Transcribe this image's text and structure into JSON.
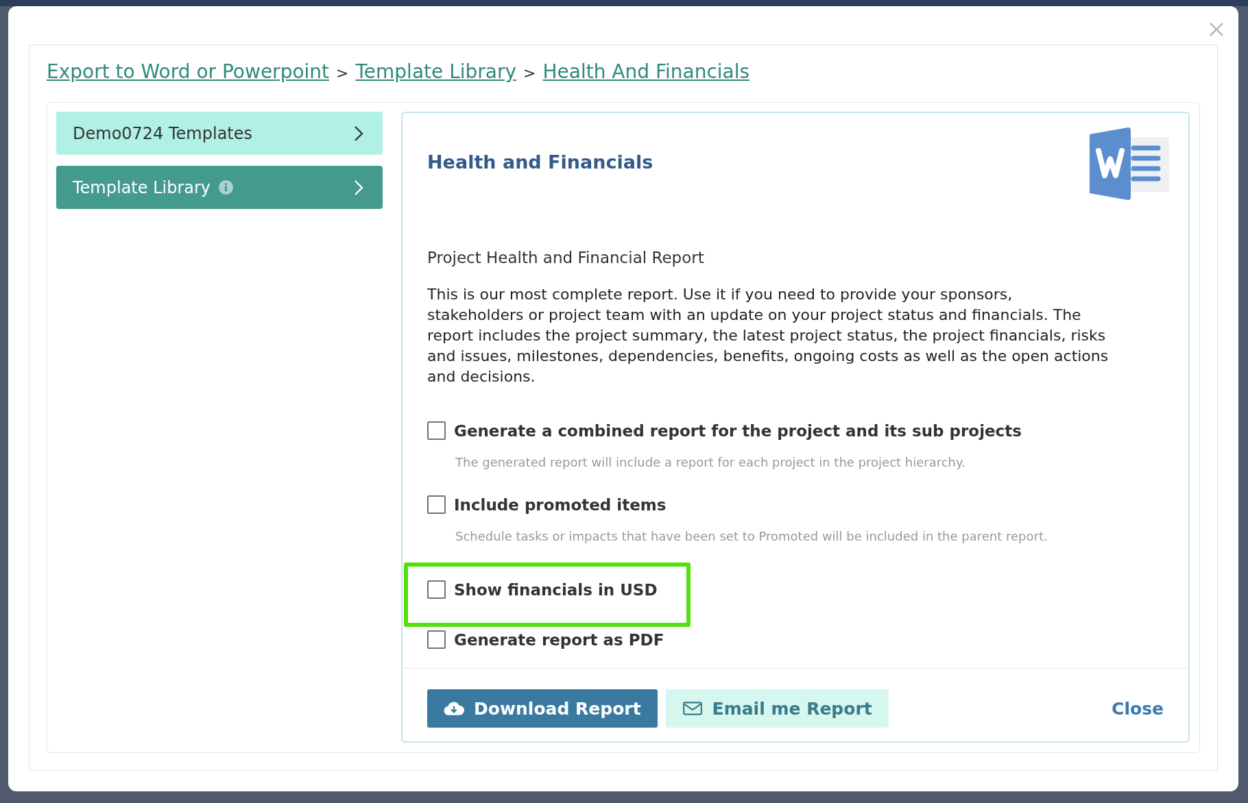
{
  "breadcrumb": [
    {
      "label": "Export to Word or Powerpoint"
    },
    {
      "label": "Template Library"
    },
    {
      "label": "Health And Financials"
    }
  ],
  "breadcrumb_separator": ">",
  "sidebar": {
    "items": [
      {
        "label": "Demo0724 Templates",
        "selected": false,
        "info": false
      },
      {
        "label": "Template Library",
        "selected": true,
        "info": true
      }
    ]
  },
  "template": {
    "title": "Health and Financials",
    "subtitle": "Project Health and Financial Report",
    "description": "This is our most complete report. Use it if you need to provide your sponsors, stakeholders or project team with an update on your project status and financials. The report includes the project summary, the latest project status, the project financials, risks and issues, milestones, dependencies, benefits, ongoing costs as well as the open actions and decisions."
  },
  "options": [
    {
      "label": "Generate a combined report for the project and its sub projects",
      "hint": "The generated report will include a report for each project in the project hierarchy.",
      "checked": false,
      "highlighted": false
    },
    {
      "label": "Include promoted items",
      "hint": "Schedule tasks or impacts that have been set to Promoted will be included in the parent report.",
      "checked": false,
      "highlighted": false
    },
    {
      "label": "Show financials in USD",
      "checked": false,
      "highlighted": true
    },
    {
      "label": "Generate report as PDF",
      "checked": false,
      "highlighted": false
    }
  ],
  "buttons": [
    {
      "kind": "download",
      "label": "Download Report"
    },
    {
      "kind": "email",
      "label": "Email me Report"
    },
    {
      "kind": "close",
      "label": "Close"
    }
  ]
}
